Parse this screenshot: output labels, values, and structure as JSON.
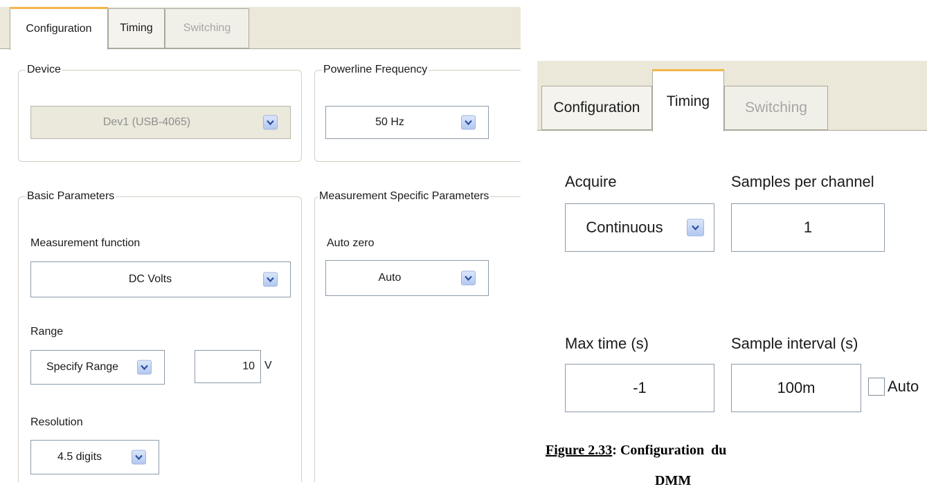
{
  "left_panel": {
    "tabs": [
      {
        "label": "Configuration",
        "state": "active"
      },
      {
        "label": "Timing",
        "state": "normal"
      },
      {
        "label": "Switching",
        "state": "disabled"
      }
    ],
    "device": {
      "legend": "Device",
      "value": "Dev1 (USB-4065)"
    },
    "powerline": {
      "legend": "Powerline Frequency",
      "value": "50 Hz"
    },
    "basic": {
      "legend": "Basic Parameters",
      "measurement_function_label": "Measurement function",
      "measurement_function_value": "DC Volts",
      "range_label": "Range",
      "range_mode_value": "Specify Range",
      "range_value": "10",
      "range_unit": "V",
      "resolution_label": "Resolution",
      "resolution_value": "4.5 digits"
    },
    "specific": {
      "legend": "Measurement Specific Parameters",
      "auto_zero_label": "Auto zero",
      "auto_zero_value": "Auto"
    }
  },
  "right_panel": {
    "tabs": [
      {
        "label": "Configuration",
        "state": "normal"
      },
      {
        "label": "Timing",
        "state": "active"
      },
      {
        "label": "Switching",
        "state": "disabled"
      }
    ],
    "acquire_label": "Acquire",
    "acquire_value": "Continuous",
    "samples_label": "Samples per channel",
    "samples_value": "1",
    "max_time_label": "Max time (s)",
    "max_time_value": "-1",
    "sample_interval_label": "Sample interval (s)",
    "sample_interval_value": "100m",
    "auto_label": "Auto",
    "auto_checked": false
  },
  "caption": {
    "figure_ref": "Figure 2.33",
    "text": ": Configuration  du",
    "line2": "DMM"
  },
  "colors": {
    "tab_accent": "#f2b648",
    "tabbar_bg": "#ebe8da",
    "dropdown_button": "#b3c8f0",
    "disabled_text": "#a6a6a6"
  }
}
